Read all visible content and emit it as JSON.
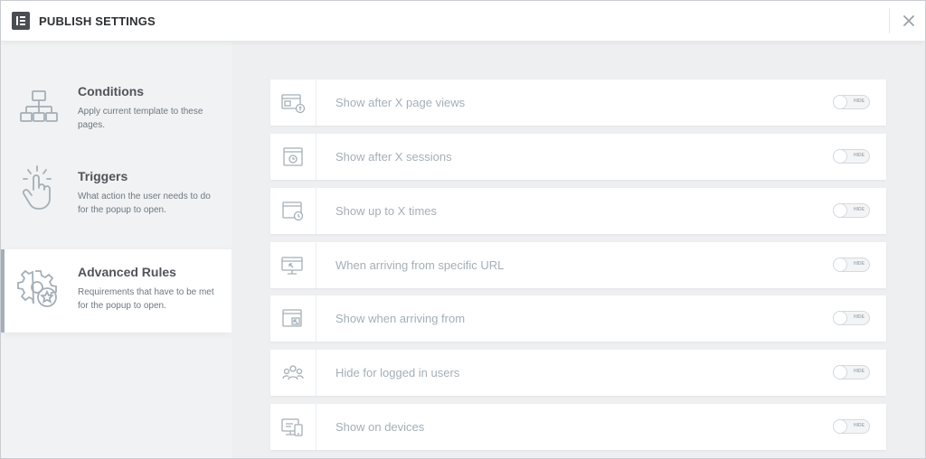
{
  "header": {
    "title": "PUBLISH SETTINGS",
    "logo_icon": "elementor-logo-icon",
    "close_icon": "close-icon"
  },
  "sidebar": {
    "items": [
      {
        "title": "Conditions",
        "description": "Apply current template to these pages.",
        "icon": "sitemap-icon",
        "active": false
      },
      {
        "title": "Triggers",
        "description": "What action the user needs to do for the popup to open.",
        "icon": "hand-pointer-icon",
        "active": false
      },
      {
        "title": "Advanced Rules",
        "description": "Requirements that have to be met for the popup to open.",
        "icon": "gear-star-icon",
        "active": true
      }
    ]
  },
  "rules": [
    {
      "label": "Show after X page views",
      "icon": "page-views-icon",
      "toggle_text": "HIDE",
      "enabled": false
    },
    {
      "label": "Show after X sessions",
      "icon": "sessions-icon",
      "toggle_text": "HIDE",
      "enabled": false
    },
    {
      "label": "Show up to X times",
      "icon": "times-icon",
      "toggle_text": "HIDE",
      "enabled": false
    },
    {
      "label": "When arriving from specific URL",
      "icon": "url-icon",
      "toggle_text": "HIDE",
      "enabled": false
    },
    {
      "label": "Show when arriving from",
      "icon": "arriving-from-icon",
      "toggle_text": "HIDE",
      "enabled": false
    },
    {
      "label": "Hide for logged in users",
      "icon": "users-icon",
      "toggle_text": "HIDE",
      "enabled": false
    },
    {
      "label": "Show on devices",
      "icon": "devices-icon",
      "toggle_text": "HIDE",
      "enabled": false
    }
  ],
  "colors": {
    "accent_bar": "#a4afb7",
    "icon": "#a4afb7",
    "text_muted": "#a4afb7",
    "title_dark": "#505459"
  }
}
